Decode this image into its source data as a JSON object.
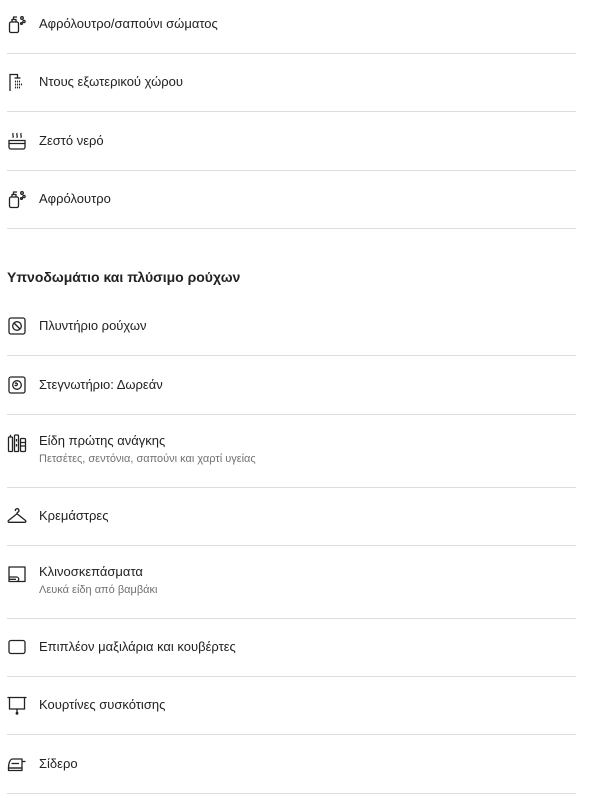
{
  "bathroom": {
    "items": [
      {
        "icon": "body-soap-icon",
        "label": "Αφρόλουτρο/σαπούνι σώματος"
      },
      {
        "icon": "outdoor-shower-icon",
        "label": "Ντους εξωτερικού χώρου"
      },
      {
        "icon": "hot-water-icon",
        "label": "Ζεστό νερό"
      },
      {
        "icon": "shower-gel-icon",
        "label": "Αφρόλουτρο"
      }
    ]
  },
  "bedroom_laundry": {
    "title": "Υπνοδωμάτιο και πλύσιμο ρούχων",
    "items": [
      {
        "icon": "washer-icon",
        "label": "Πλυντήριο ρούχων"
      },
      {
        "icon": "dryer-icon",
        "label": "Στεγνωτήριο: Δωρεάν"
      },
      {
        "icon": "essentials-icon",
        "label": "Είδη πρώτης ανάγκης",
        "sub": "Πετσέτες, σεντόνια, σαπούνι και χαρτί υγείας"
      },
      {
        "icon": "hangers-icon",
        "label": "Κρεμάστρες"
      },
      {
        "icon": "bed-linens-icon",
        "label": "Κλινοσκεπάσματα",
        "sub": "Λευκά είδη από βαμβάκι"
      },
      {
        "icon": "extra-pillows-icon",
        "label": "Επιπλέον μαξιλάρια και κουβέρτες"
      },
      {
        "icon": "blackout-shades-icon",
        "label": "Κουρτίνες συσκότισης"
      },
      {
        "icon": "iron-icon",
        "label": "Σίδερο"
      }
    ]
  }
}
